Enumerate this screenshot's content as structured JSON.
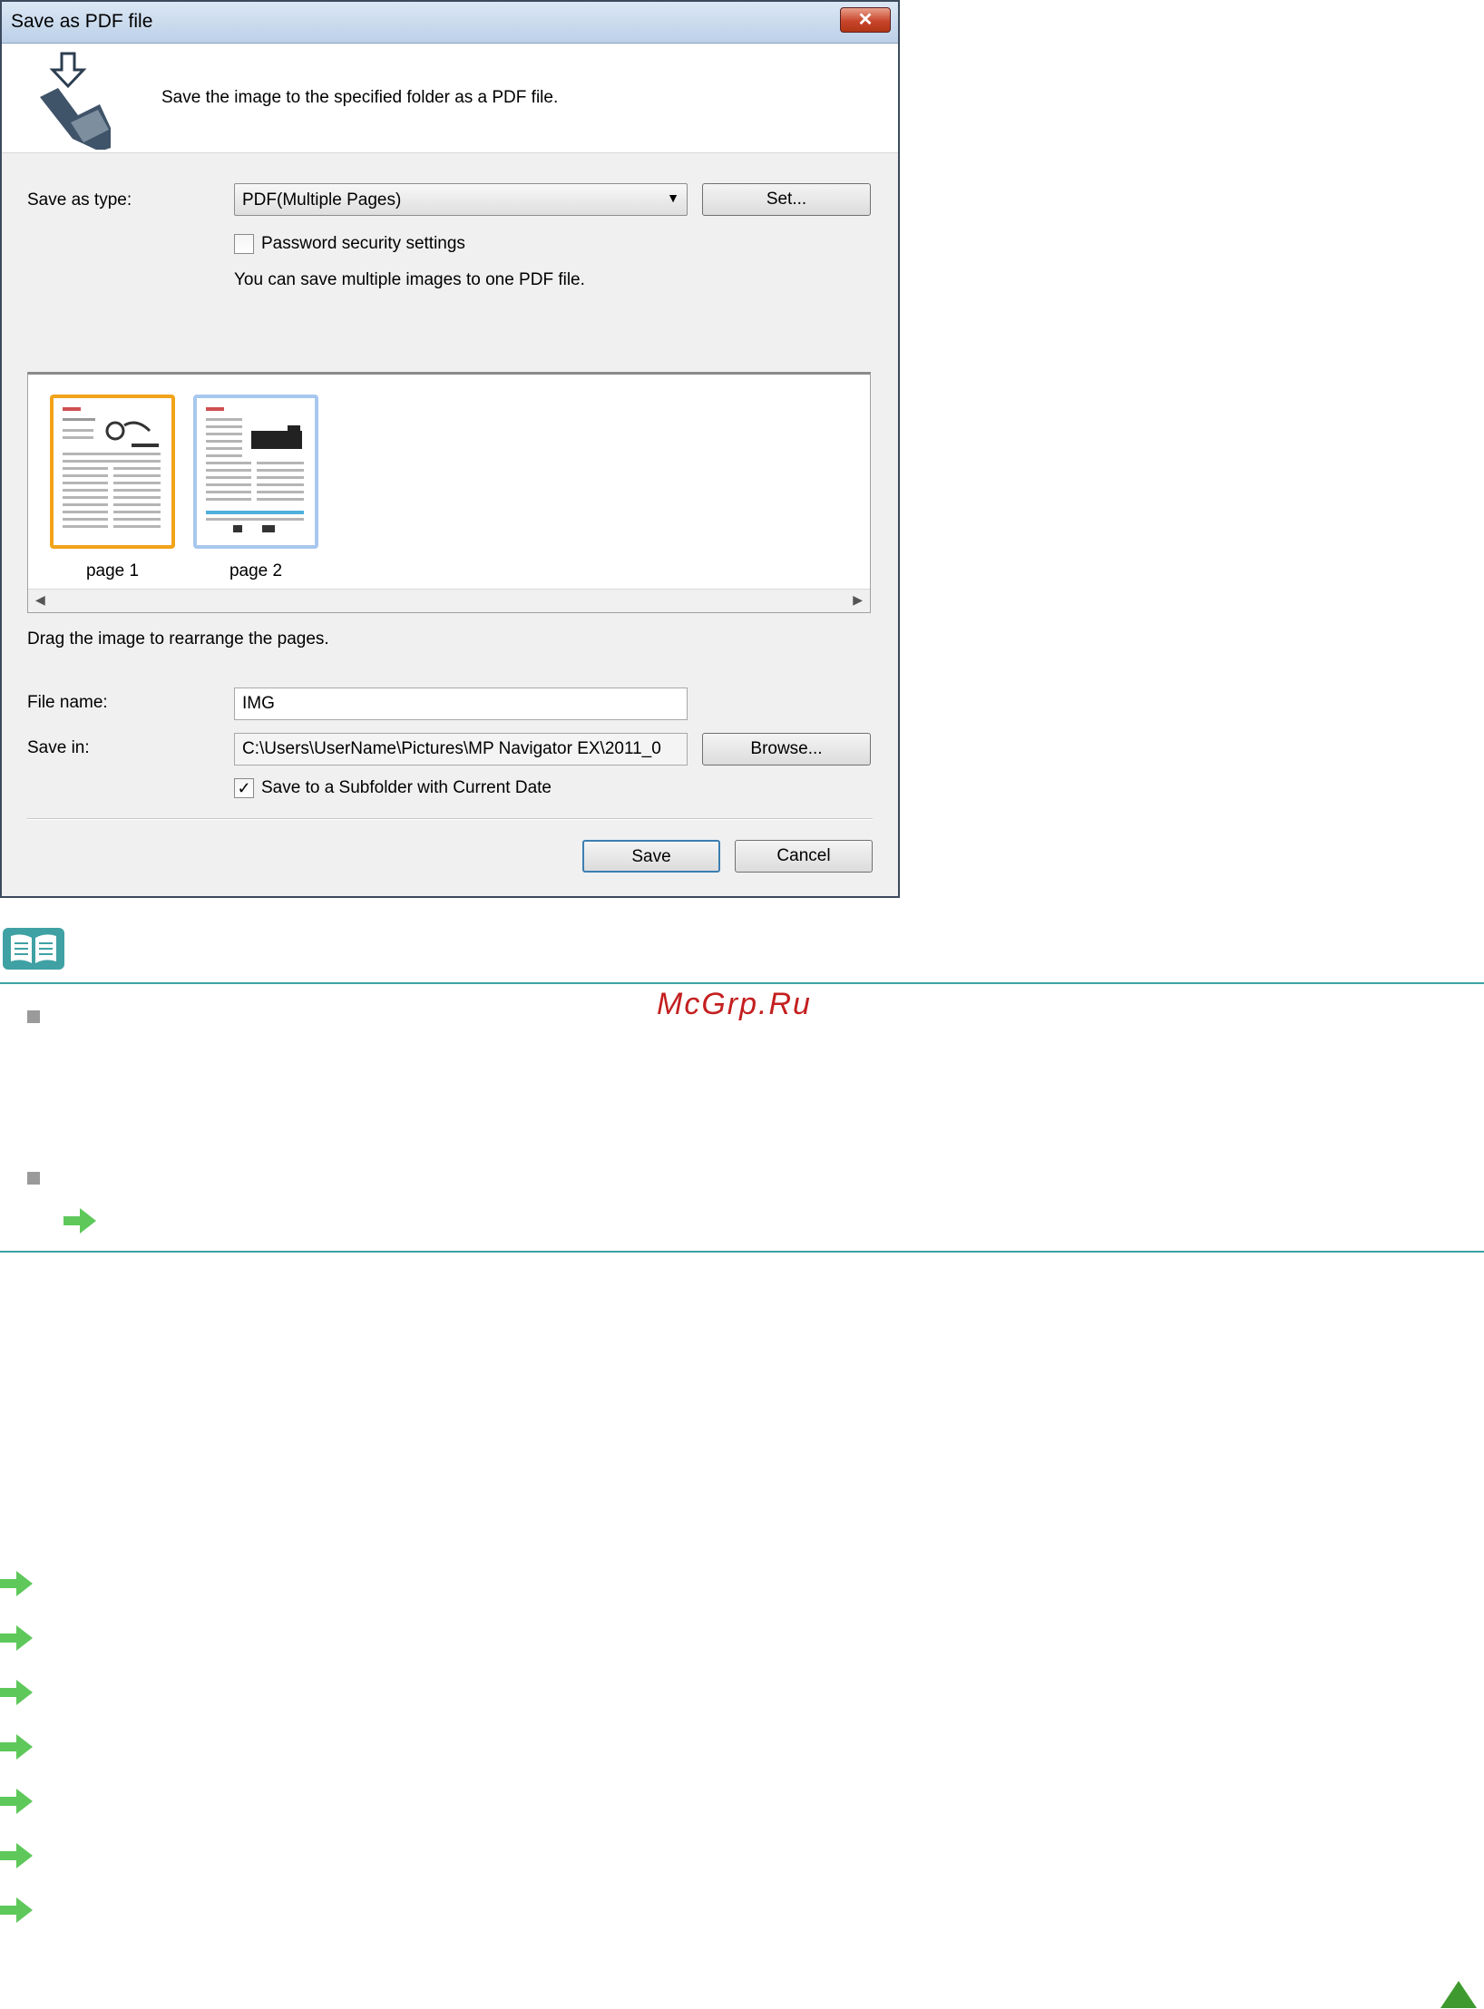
{
  "dialog": {
    "title": "Save as PDF file",
    "close_label": "✕",
    "description": "Save the image to the specified folder as a PDF file.",
    "save_as_type_label": "Save as type:",
    "save_as_type_value": "PDF(Multiple Pages)",
    "set_button": "Set...",
    "password_checkbox_label": "Password security settings",
    "password_checked": false,
    "multi_info": "You can save multiple images to one PDF file.",
    "pages": [
      {
        "label": "page 1",
        "selected": true
      },
      {
        "label": "page 2",
        "selected": false
      }
    ],
    "drag_hint": "Drag the image to rearrange the pages.",
    "file_name_label": "File name:",
    "file_name_value": "IMG",
    "save_in_label": "Save in:",
    "save_in_value": "C:\\Users\\UserName\\Pictures\\MP Navigator EX\\2011_0",
    "browse_button": "Browse...",
    "subfolder_label": "Save to a Subfolder with Current Date",
    "subfolder_checked": true,
    "save_button": "Save",
    "cancel_button": "Cancel"
  },
  "watermark": "McGrp.Ru",
  "colors": {
    "rule": "#3fa1a4",
    "arrow_green": "#5ec85a",
    "up_arrow_green": "#3e9a2e",
    "watermark_red": "#c41f1f"
  }
}
